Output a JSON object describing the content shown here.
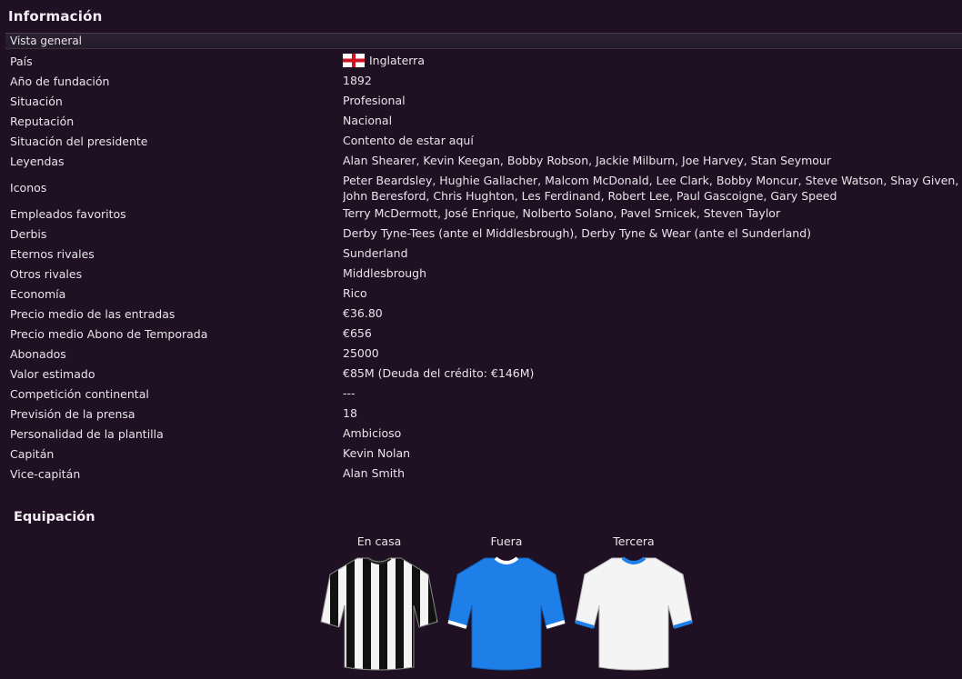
{
  "panel": {
    "title": "Información",
    "section_tab": "Vista general"
  },
  "info_rows": [
    {
      "label": "País",
      "value": "Inglaterra",
      "flag": "england-flag"
    },
    {
      "label": "Año de fundación",
      "value": "1892"
    },
    {
      "label": "Situación",
      "value": "Profesional"
    },
    {
      "label": "Reputación",
      "value": "Nacional"
    },
    {
      "label": "Situación del presidente",
      "value": "Contento de estar aquí"
    },
    {
      "label": "Leyendas",
      "value": "Alan Shearer, Kevin Keegan, Bobby Robson, Jackie Milburn, Joe Harvey, Stan Seymour"
    },
    {
      "label": "Iconos",
      "value": "Peter Beardsley, Hughie Gallacher, Malcom McDonald, Lee Clark, Bobby Moncur, Steve Watson, Shay Given, John Beresford, Chris Hughton, Les Ferdinand, Robert Lee, Paul Gascoigne, Gary Speed"
    },
    {
      "label": "Empleados favoritos",
      "value": "Terry McDermott, José Enrique, Nolberto Solano, Pavel Srnicek, Steven Taylor"
    },
    {
      "label": "Derbis",
      "value": "Derby Tyne-Tees (ante el Middlesbrough), Derby Tyne & Wear (ante el Sunderland)"
    },
    {
      "label": "Eternos rivales",
      "value": "Sunderland"
    },
    {
      "label": "Otros rivales",
      "value": "Middlesbrough"
    },
    {
      "label": "Economía",
      "value": "Rico"
    },
    {
      "label": "Precio medio de las entradas",
      "value": "€36.80"
    },
    {
      "label": "Precio medio Abono de Temporada",
      "value": "€656"
    },
    {
      "label": "Abonados",
      "value": "25000"
    },
    {
      "label": "Valor estimado",
      "value": "€85M (Deuda del crédito: €146M)"
    },
    {
      "label": "Competición continental",
      "value": "---"
    },
    {
      "label": "Previsión de la prensa",
      "value": "18"
    },
    {
      "label": "Personalidad de la plantilla",
      "value": "Ambicioso"
    },
    {
      "label": "Capitán",
      "value": "Kevin Nolan"
    },
    {
      "label": "Vice-capitán",
      "value": "Alan Smith"
    }
  ],
  "kits": {
    "title": "Equipación",
    "items": [
      {
        "label": "En casa",
        "style": "stripes",
        "body_color": "#ffffff",
        "stripe_color": "#111111",
        "trim_color": "#222222"
      },
      {
        "label": "Fuera",
        "style": "plain",
        "body_color": "#1e7fe8",
        "trim_color": "#ffffff"
      },
      {
        "label": "Tercera",
        "style": "plain",
        "body_color": "#f4f4f4",
        "trim_color": "#1e7fe8"
      }
    ]
  },
  "colors": {
    "background": "#1f1123",
    "text": "#e8e4ea"
  }
}
